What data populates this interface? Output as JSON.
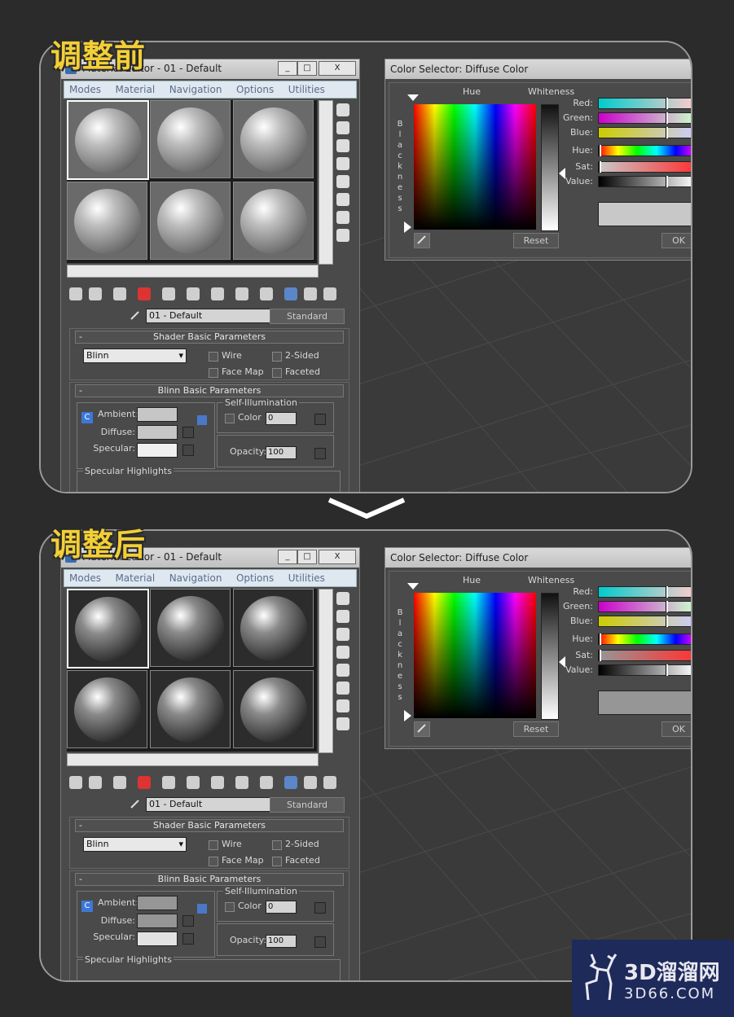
{
  "labels": {
    "before": "调整前",
    "after": "调整后"
  },
  "material_editor": {
    "title": "Material Editor - 01 - Default",
    "window_buttons": [
      "_",
      "□",
      "X"
    ],
    "menu": [
      "Modes",
      "Material",
      "Navigation",
      "Options",
      "Utilities"
    ],
    "material_name": "01 - Default",
    "material_type": "Standard",
    "shader_rollout": {
      "title": "Shader Basic Parameters",
      "shader": "Blinn",
      "wire": "Wire",
      "two_sided": "2-Sided",
      "face_map": "Face Map",
      "faceted": "Faceted"
    },
    "blinn_rollout": {
      "title": "Blinn Basic Parameters",
      "self_illum": "Self-Illumination",
      "color": "Color",
      "color_value": "0",
      "ambient": "Ambient:",
      "diffuse": "Diffuse:",
      "specular": "Specular:",
      "opacity": "Opacity:",
      "opacity_value": "100",
      "lock_c": "C"
    },
    "specular_highlights": "Specular Highlights"
  },
  "color_selector": {
    "title": "Color Selector: Diffuse Color",
    "hue_label": "Hue",
    "whiteness_label": "Whiteness",
    "blackness_label": "Blackness",
    "red": "Red:",
    "green": "Green:",
    "blue": "Blue:",
    "hue": "Hue:",
    "sat": "Sat:",
    "value": "Value:",
    "reset": "Reset",
    "ok": "OK"
  },
  "states": {
    "before": {
      "diffuse": "#c6c6c6",
      "ambient": "#c6c6c6",
      "specular": "#efefef",
      "sphere_bg": "#6a6a6a",
      "sphere": "#bdbdbd",
      "preview": "#c8c8c8"
    },
    "after": {
      "diffuse": "#969696",
      "ambient": "#969696",
      "specular": "#e2e2e2",
      "sphere_bg": "#2c2c2c",
      "sphere": "#8a8a8a",
      "preview": "#969696"
    }
  },
  "watermark": {
    "name": "3D溜溜网",
    "site": "3D66.COM"
  }
}
